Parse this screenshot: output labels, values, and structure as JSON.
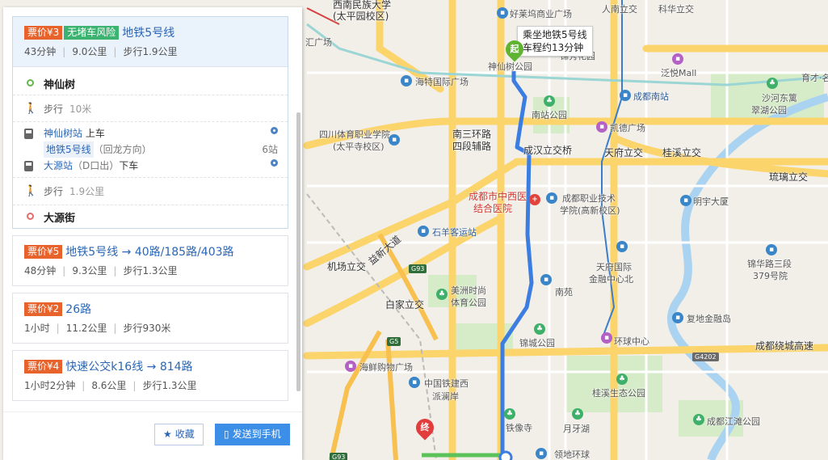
{
  "panel": {
    "routes": [
      {
        "price": "票价¥3",
        "flag": "无堵车风险",
        "name": "地铁5号线",
        "duration": "43分钟",
        "distance": "9.0公里",
        "walk": "步行1.9公里"
      },
      {
        "price": "票价¥5",
        "name": "地铁5号线 → 40路/185路/403路",
        "duration": "48分钟",
        "distance": "9.3公里",
        "walk": "步行1.3公里"
      },
      {
        "price": "票价¥2",
        "name": "26路",
        "duration": "1小时",
        "distance": "11.2公里",
        "walk": "步行930米"
      },
      {
        "price": "票价¥4",
        "name": "快速公交k16线 → 814路",
        "duration": "1小时2分钟",
        "distance": "8.6公里",
        "walk": "步行1.3公里"
      }
    ],
    "detail": {
      "start": "神仙树",
      "walk1_label": "步行",
      "walk1_dist": "10米",
      "board_station": "神仙树站",
      "board_action": "上车",
      "line": "地铁5号线",
      "direction": "（回龙方向）",
      "stops": "6站",
      "alight_station": "大源站",
      "alight_exit": "（D口出）",
      "alight_action": "下车",
      "walk2_label": "步行",
      "walk2_dist": "1.9公里",
      "end": "大源街"
    },
    "footer": {
      "favorite": "收藏",
      "send": "发送到手机"
    }
  },
  "map": {
    "route_tip_line1": "乘坐地铁5号线",
    "route_tip_line2": "车程约13分钟",
    "start_pin": "起",
    "end_pin": "终",
    "labels": [
      {
        "id": "l1",
        "text": "西南民族大学"
      },
      {
        "id": "l2",
        "text": "(太平园校区)"
      },
      {
        "id": "l3",
        "text": "好莱坞商业广场"
      },
      {
        "id": "l4",
        "text": "人南立交"
      },
      {
        "id": "l5",
        "text": "科华立交"
      },
      {
        "id": "l6",
        "text": "锦秀花园"
      },
      {
        "id": "l7",
        "text": "海特国际广场"
      },
      {
        "id": "l8",
        "text": "泛悦Mall"
      },
      {
        "id": "l9",
        "text": "育才·名"
      },
      {
        "id": "l10",
        "text": "成都南站"
      },
      {
        "id": "l11",
        "text": "沙河东篱"
      },
      {
        "id": "l12",
        "text": "翠湖公园"
      },
      {
        "id": "l13",
        "text": "南站公园"
      },
      {
        "id": "l14",
        "text": "四川体育职业学院"
      },
      {
        "id": "l15",
        "text": "(太平寺校区)"
      },
      {
        "id": "l16",
        "text": "南三环路"
      },
      {
        "id": "l17",
        "text": "四段辅路"
      },
      {
        "id": "l18",
        "text": "凯德广场"
      },
      {
        "id": "l19",
        "text": "成汉立交桥"
      },
      {
        "id": "l20",
        "text": "天府立交"
      },
      {
        "id": "l21",
        "text": "桂溪立交"
      },
      {
        "id": "l22",
        "text": "琉璃立交"
      },
      {
        "id": "l23",
        "text": "成都市中西医"
      },
      {
        "id": "l24",
        "text": "结合医院"
      },
      {
        "id": "l25",
        "text": "成都职业技术"
      },
      {
        "id": "l26",
        "text": "学院(高新校区)"
      },
      {
        "id": "l27",
        "text": "明宇大厦"
      },
      {
        "id": "l28",
        "text": "石羊客运站"
      },
      {
        "id": "l29",
        "text": "机场立交"
      },
      {
        "id": "l30",
        "text": "益新大道"
      },
      {
        "id": "l31",
        "text": "天府国际"
      },
      {
        "id": "l32",
        "text": "金融中心北"
      },
      {
        "id": "l33",
        "text": "锦华路三段"
      },
      {
        "id": "l34",
        "text": "379号院"
      },
      {
        "id": "l35",
        "text": "美洲时尚"
      },
      {
        "id": "l36",
        "text": "体育公园"
      },
      {
        "id": "l37",
        "text": "南苑"
      },
      {
        "id": "l38",
        "text": "白家立交"
      },
      {
        "id": "l39",
        "text": "复地金融岛"
      },
      {
        "id": "l40",
        "text": "锦城公园"
      },
      {
        "id": "l41",
        "text": "环球中心"
      },
      {
        "id": "l42",
        "text": "成都绕城高速"
      },
      {
        "id": "l43",
        "text": "海鲜购物广场"
      },
      {
        "id": "l44",
        "text": "中国铁建西"
      },
      {
        "id": "l45",
        "text": "派澜岸"
      },
      {
        "id": "l46",
        "text": "桂溪生态公园"
      },
      {
        "id": "l47",
        "text": "铁像寺"
      },
      {
        "id": "l48",
        "text": "月牙湖"
      },
      {
        "id": "l49",
        "text": "成都江滩公园"
      },
      {
        "id": "l50",
        "text": "领地环球"
      },
      {
        "id": "l51",
        "text": "汇广场"
      },
      {
        "id": "l52",
        "text": "神仙树公园"
      }
    ],
    "shields": [
      {
        "id": "s1",
        "text": "G93"
      },
      {
        "id": "s2",
        "text": "G5"
      },
      {
        "id": "s3",
        "text": "G4202"
      },
      {
        "id": "s4",
        "text": "G93"
      }
    ]
  }
}
